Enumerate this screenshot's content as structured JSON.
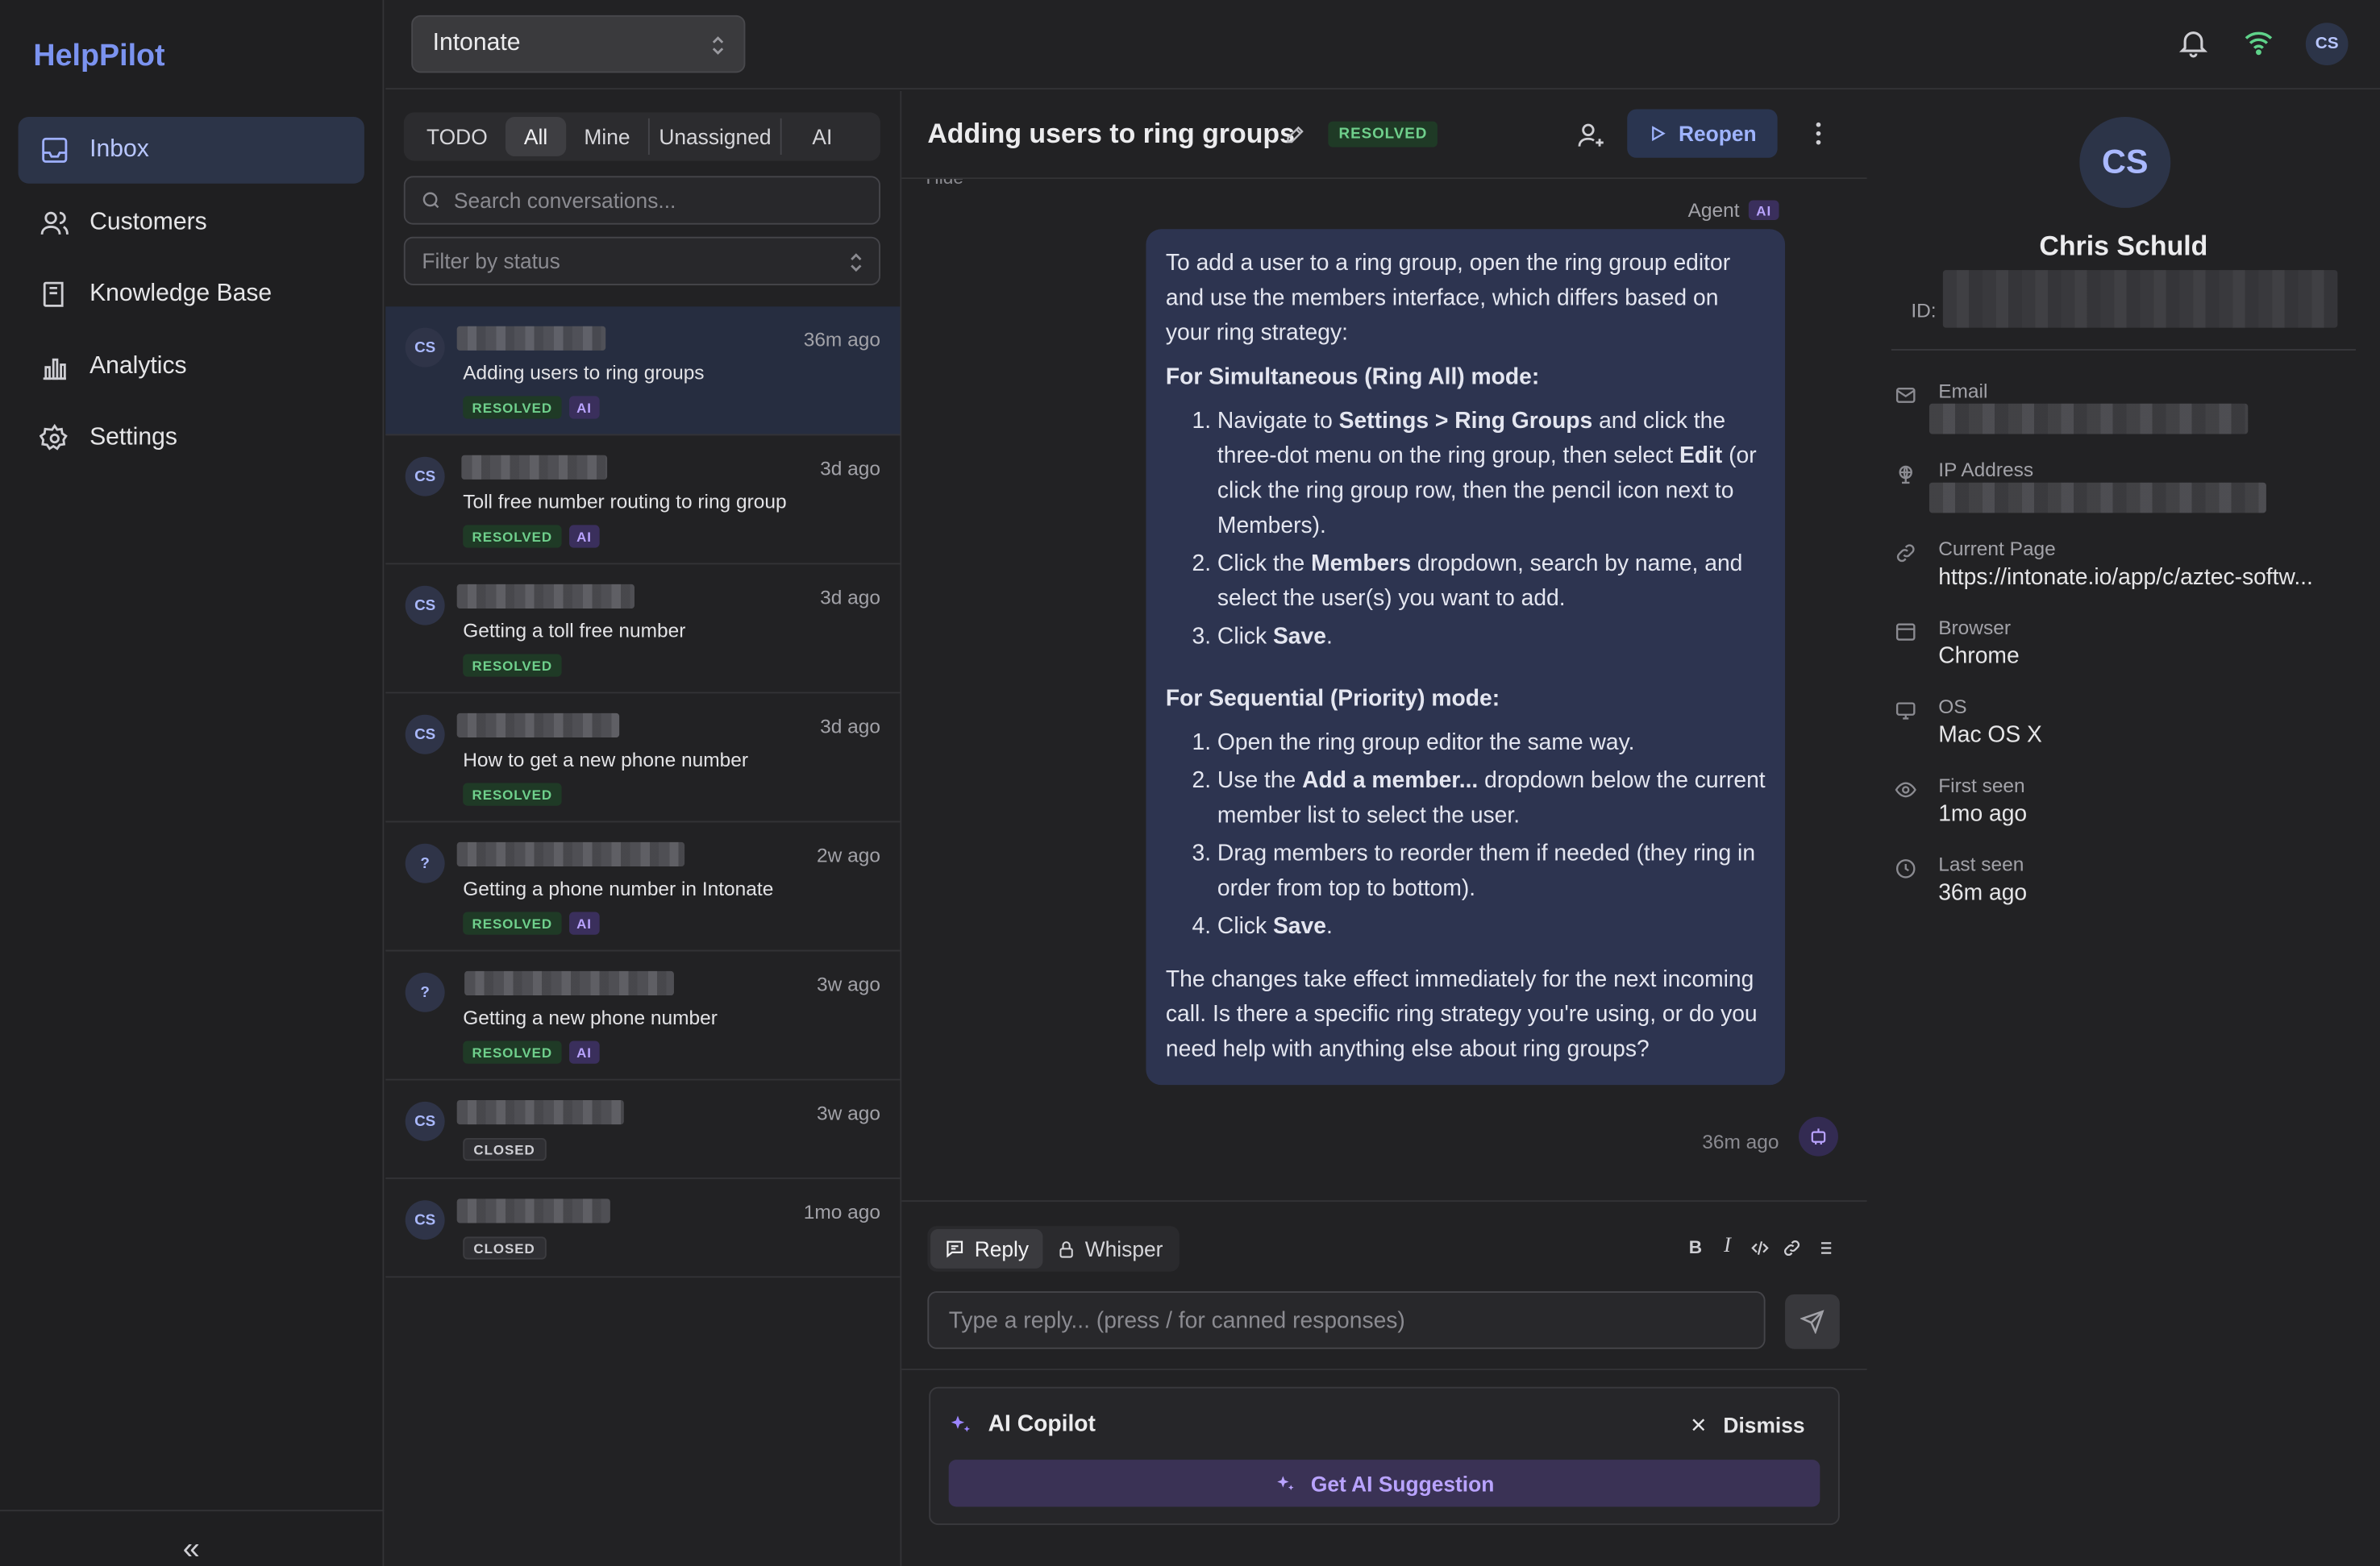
{
  "sidebar": {
    "brand": "HelpPilot",
    "items": [
      {
        "label": "Inbox",
        "icon": "inbox-icon"
      },
      {
        "label": "Customers",
        "icon": "users-icon"
      },
      {
        "label": "Knowledge Base",
        "icon": "book-icon"
      },
      {
        "label": "Analytics",
        "icon": "bar-chart-icon"
      },
      {
        "label": "Settings",
        "icon": "gear-icon"
      }
    ],
    "collapse_glyph": "«"
  },
  "topbar": {
    "workspace": "Intonate",
    "user_initials": "CS"
  },
  "list": {
    "filters": [
      "TODO",
      "All",
      "Mine",
      "Unassigned",
      "AI"
    ],
    "active_filter": "All",
    "search_placeholder": "Search conversations...",
    "status_placeholder": "Filter by status",
    "conversations": [
      {
        "initials": "CS",
        "time": "36m ago",
        "subject": "Adding users to ring groups",
        "status": "RESOLVED",
        "ai": "AI"
      },
      {
        "initials": "CS",
        "time": "3d ago",
        "subject": "Toll free number routing to ring group",
        "status": "RESOLVED",
        "ai": "AI"
      },
      {
        "initials": "CS",
        "time": "3d ago",
        "subject": "Getting a toll free number",
        "status": "RESOLVED",
        "ai": ""
      },
      {
        "initials": "CS",
        "time": "3d ago",
        "subject": "How to get a new phone number",
        "status": "RESOLVED",
        "ai": ""
      },
      {
        "initials": "?",
        "time": "2w ago",
        "subject": "Getting a phone number in Intonate",
        "status": "RESOLVED",
        "ai": "AI"
      },
      {
        "initials": "?",
        "time": "3w ago",
        "subject": "Getting a new phone number",
        "status": "RESOLVED",
        "ai": "AI"
      },
      {
        "initials": "CS",
        "time": "3w ago",
        "subject": "",
        "status": "CLOSED",
        "ai": ""
      },
      {
        "initials": "CS",
        "time": "1mo ago",
        "subject": "",
        "status": "CLOSED",
        "ai": ""
      }
    ]
  },
  "conversation": {
    "title": "Adding users to ring groups",
    "status": "RESOLVED",
    "reopen_label": "Reopen",
    "hide_fragment": "Hide",
    "agent_label": "Agent",
    "agent_badge": "AI",
    "message": {
      "intro": "To add a user to a ring group, open the ring group editor and use the members interface, which differs based on your ring strategy:",
      "section1_title": "For Simultaneous (Ring All) mode:",
      "s1_1_a": "Navigate to ",
      "s1_1_b": "Settings > Ring Groups",
      "s1_1_c": " and click the three-dot menu on the ring group, then select ",
      "s1_1_d": "Edit",
      "s1_1_e": " (or click the ring group row, then the pencil icon next to Members).",
      "s1_2_a": "Click the ",
      "s1_2_b": "Members",
      "s1_2_c": " dropdown, search by name, and select the user(s) you want to add.",
      "s1_3_a": "Click ",
      "s1_3_b": "Save",
      "s1_3_c": ".",
      "section2_title": "For Sequential (Priority) mode:",
      "s2_1": "Open the ring group editor the same way.",
      "s2_2_a": "Use the ",
      "s2_2_b": "Add a member...",
      "s2_2_c": " dropdown below the current member list to select the user.",
      "s2_3": "Drag members to reorder them if needed (they ring in order from top to bottom).",
      "s2_4_a": "Click ",
      "s2_4_b": "Save",
      "s2_4_c": ".",
      "outro": "The changes take effect immediately for the next incoming call. Is there a specific ring strategy you're using, or do you need help with anything else about ring groups?",
      "time": "36m ago"
    }
  },
  "composer": {
    "reply_tab": "Reply",
    "whisper_tab": "Whisper",
    "placeholder": "Type a reply... (press / for canned responses)",
    "format_bold": "B",
    "format_italic": "I"
  },
  "copilot": {
    "title": "AI Copilot",
    "dismiss": "Dismiss",
    "suggest": "Get AI Suggestion"
  },
  "details": {
    "initials": "CS",
    "name": "Chris Schuld",
    "id_label": "ID:",
    "fields": [
      {
        "label": "Email",
        "value": ""
      },
      {
        "label": "IP Address",
        "value": ""
      },
      {
        "label": "Current Page",
        "value": "https://intonate.io/app/c/aztec-softw..."
      },
      {
        "label": "Browser",
        "value": "Chrome"
      },
      {
        "label": "OS",
        "value": "Mac OS X"
      },
      {
        "label": "First seen",
        "value": "1mo ago"
      },
      {
        "label": "Last seen",
        "value": "36m ago"
      }
    ]
  },
  "colors": {
    "accent": "#7b93f0",
    "resolved": "#6fd08c",
    "ai": "#b9a3ff",
    "bubble": "#2d3450"
  }
}
